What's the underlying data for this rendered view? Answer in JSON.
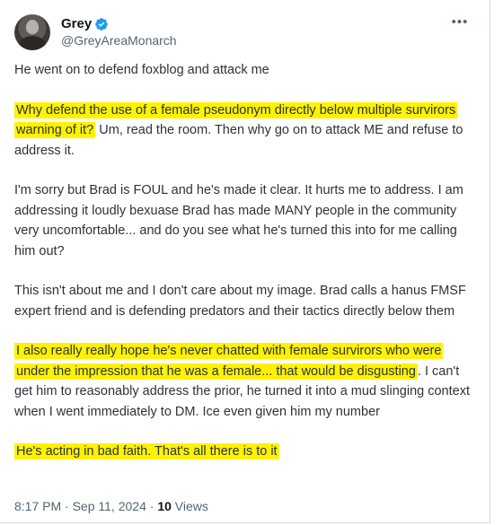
{
  "author": {
    "display_name": "Grey",
    "handle": "@GreyAreaMonarch"
  },
  "post": {
    "p1": "He went on to defend foxblog and attack me",
    "p2_highlight": "Why defend the use of a female pseudonym directly below multiple survirors warning of it?",
    "p2_rest": " Um, read the room. Then why go on to attack ME and refuse to address it.",
    "p3": "I'm sorry but Brad is FOUL and he's made it clear. It hurts me to address. I am addressing it loudly bexuase Brad has made MANY people in the community very uncomfortable... and do you see what he's turned this into for me calling him out?",
    "p4": "This isn't about me and I don't care about my image. Brad calls a hanus FMSF expert friend and is defending predators and their tactics directly below them",
    "p5_highlight": "I also really really hope he's never chatted with female survirors who were under the impression that he was a female... that would be disgusting",
    "p5_rest": ". I can't get him to reasonably address the prior, he turned it into a mud slinging context when I went immediately to DM.  Ice even given him my number",
    "p6_highlight": "He's acting in bad faith. That's all there is to it"
  },
  "meta": {
    "time": "8:17 PM",
    "sep1": " · ",
    "date": "Sep 11, 2024",
    "sep2": " · ",
    "views_count": "10",
    "views_label": " Views"
  },
  "colors": {
    "highlight": "#fff200",
    "verified": "#1d9bf0",
    "secondary_text": "#536471"
  },
  "icons": {
    "verified": "verified-badge-icon",
    "more": "more-options-icon"
  }
}
